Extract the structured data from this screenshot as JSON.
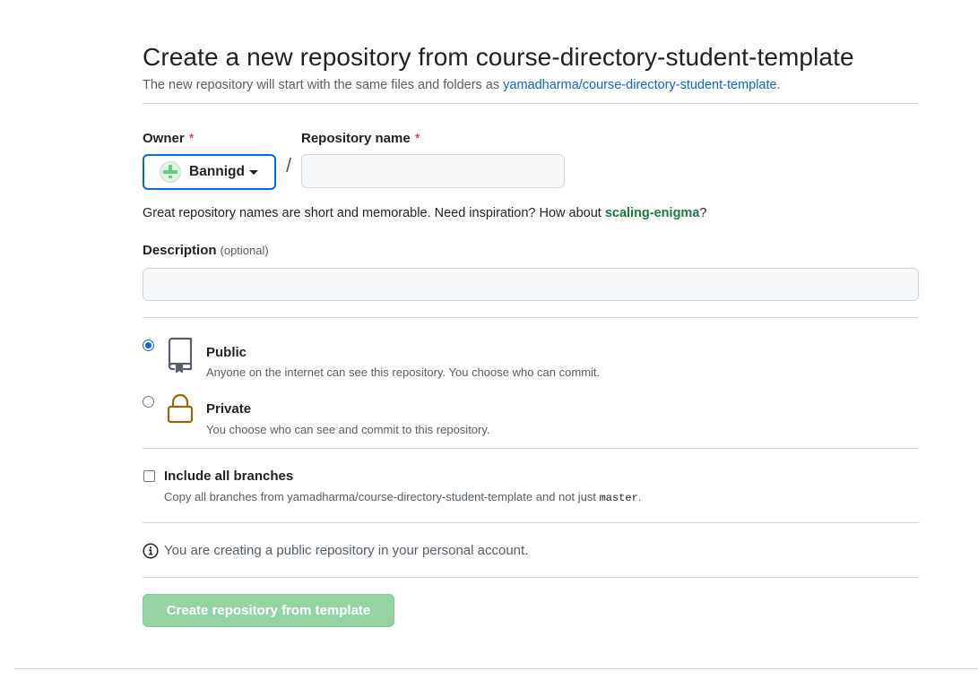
{
  "header": {
    "title": "Create a new repository from course-directory-student-template",
    "subtitle_prefix": "The new repository will start with the same files and folders as ",
    "template_link": "yamadharma/course-directory-student-template",
    "subtitle_suffix": "."
  },
  "owner": {
    "label": "Owner",
    "required_mark": "*",
    "selected": "Bannigd",
    "avatar_icon": "identicon-avatar"
  },
  "separator": "/",
  "repo_name": {
    "label": "Repository name",
    "required_mark": "*",
    "value": "",
    "placeholder": ""
  },
  "hint": {
    "prefix": "Great repository names are short and memorable. Need inspiration? How about ",
    "suggestion": "scaling-enigma",
    "suffix": "?"
  },
  "description": {
    "label": "Description",
    "optional": "(optional)",
    "value": "",
    "placeholder": ""
  },
  "visibility": {
    "selected": "public",
    "options": [
      {
        "id": "public",
        "title": "Public",
        "desc": "Anyone on the internet can see this repository. You choose who can commit.",
        "icon": "repo-icon"
      },
      {
        "id": "private",
        "title": "Private",
        "desc": "You choose who can see and commit to this repository.",
        "icon": "lock-icon"
      }
    ]
  },
  "branches": {
    "title": "Include all branches",
    "desc_prefix": "Copy all branches from yamadharma/course-directory-student-template and not just ",
    "desc_code": "master",
    "desc_suffix": ".",
    "checked": false
  },
  "info": {
    "icon": "info-icon",
    "text": "You are creating a public repository in your personal account."
  },
  "submit": {
    "label": "Create repository from template",
    "enabled": false
  },
  "colors": {
    "link": "#0969da",
    "suggestion": "#1a7f37",
    "required": "#cf222e",
    "submit_disabled_bg": "#94d3a2",
    "private_icon": "#9a6700"
  }
}
